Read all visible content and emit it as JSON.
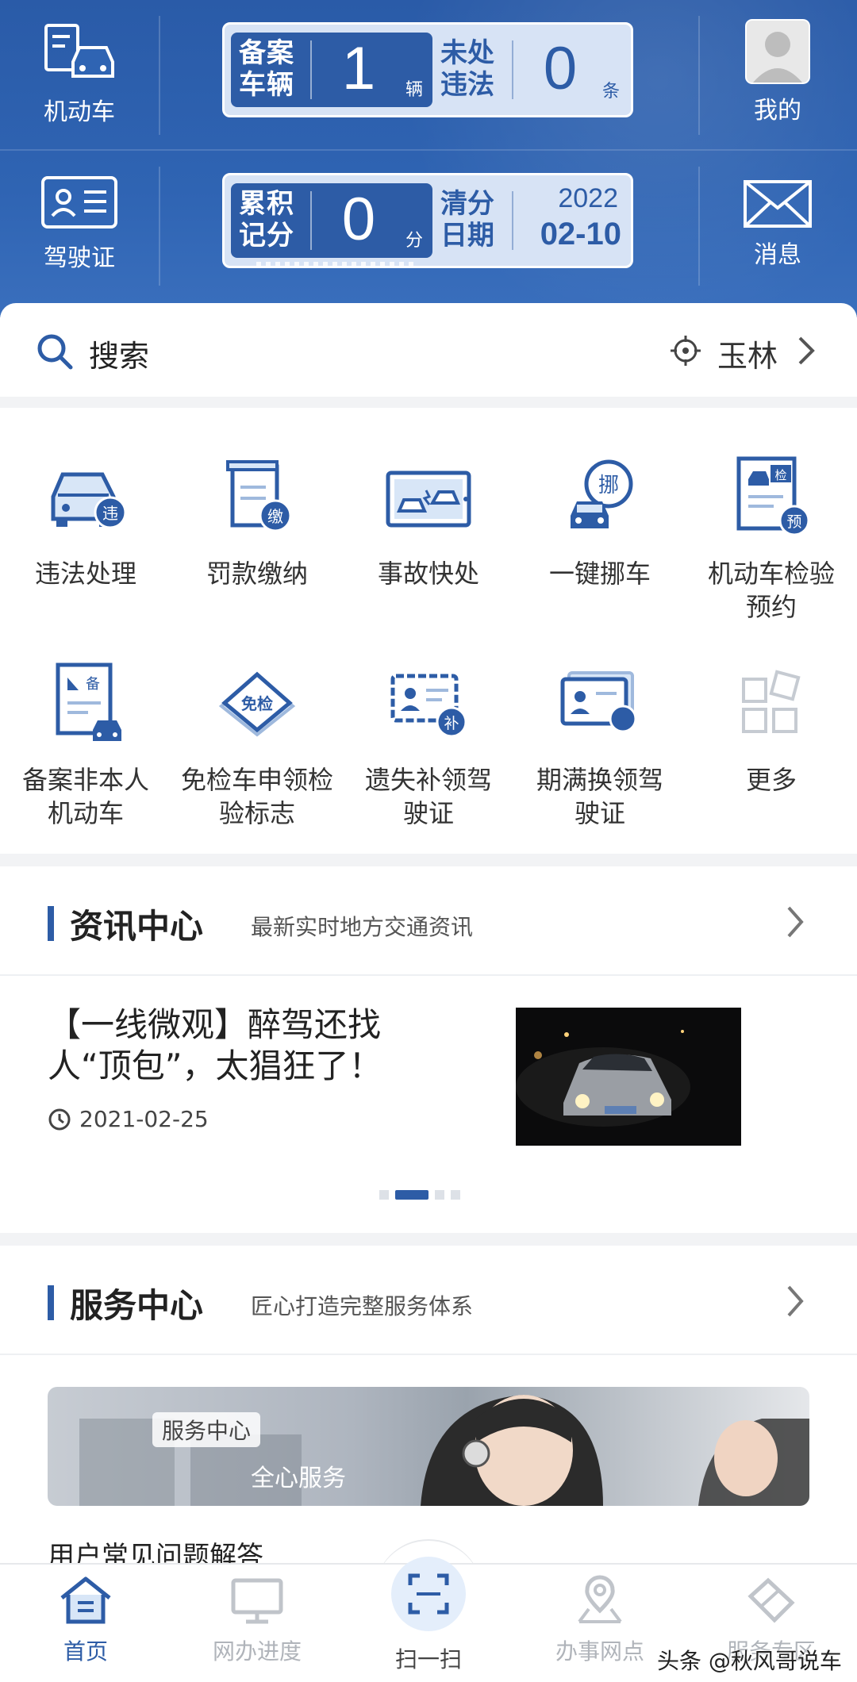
{
  "header": {
    "vehicle_label": "机动车",
    "license_label": "驾驶证",
    "me_label": "我的",
    "msg_label": "消息",
    "card1": {
      "left_title": "备案车辆",
      "left_value": "1",
      "left_unit": "辆",
      "right_title": "未处违法",
      "right_value": "0",
      "right_unit": "条"
    },
    "card2": {
      "left_title": "累积记分",
      "left_value": "0",
      "left_unit": "分",
      "right_title": "清分日期",
      "right_year": "2022",
      "right_date": "02-10"
    }
  },
  "search": {
    "label": "搜索",
    "city": "玉林"
  },
  "services": [
    {
      "label": "违法处理",
      "icon": "car-violation-icon"
    },
    {
      "label": "罚款缴纳",
      "icon": "fine-payment-icon"
    },
    {
      "label": "事故快处",
      "icon": "accident-icon"
    },
    {
      "label": "一键挪车",
      "icon": "move-car-icon"
    },
    {
      "label": "机动车检验预约",
      "icon": "inspection-booking-icon"
    },
    {
      "label": "备案非本人机动车",
      "icon": "register-vehicle-icon"
    },
    {
      "label": "免检车申领检验标志",
      "icon": "exempt-inspection-icon"
    },
    {
      "label": "遗失补领驾驶证",
      "icon": "reissue-license-icon"
    },
    {
      "label": "期满换领驾驶证",
      "icon": "renew-license-icon"
    },
    {
      "label": "更多",
      "icon": "more-icon"
    }
  ],
  "icon_badges": {
    "violation": "违",
    "fine": "缴",
    "move": "挪",
    "inspect_top": "检",
    "inspect_bottom": "预",
    "register": "备",
    "exempt": "免检",
    "reissue": "补"
  },
  "news": {
    "title": "资讯中心",
    "subtitle": "最新实时地方交通资讯",
    "item_title": "【一线微观】醉驾还找人“顶包”，太猖狂了！",
    "item_date": "2021-02-25"
  },
  "service_center": {
    "title": "服务中心",
    "subtitle": "匠心打造完整服务体系",
    "banner_tag": "服务中心",
    "banner_slogan": "全心服务",
    "faq_title": "用户常见问题解答"
  },
  "bottom_nav": [
    {
      "label": "首页",
      "icon": "home-icon",
      "active": true
    },
    {
      "label": "网办进度",
      "icon": "monitor-icon",
      "active": false
    },
    {
      "label": "扫一扫",
      "icon": "scan-icon",
      "active": false
    },
    {
      "label": "办事网点",
      "icon": "location-pin-icon",
      "active": false
    },
    {
      "label": "服务专区",
      "icon": "handshake-icon",
      "active": false
    }
  ],
  "watermark": "头条 @秋风哥说车",
  "colors": {
    "brand_blue": "#2d5ca6",
    "header_bg": "#2f64b3",
    "card_bg": "#d7e3f5"
  }
}
